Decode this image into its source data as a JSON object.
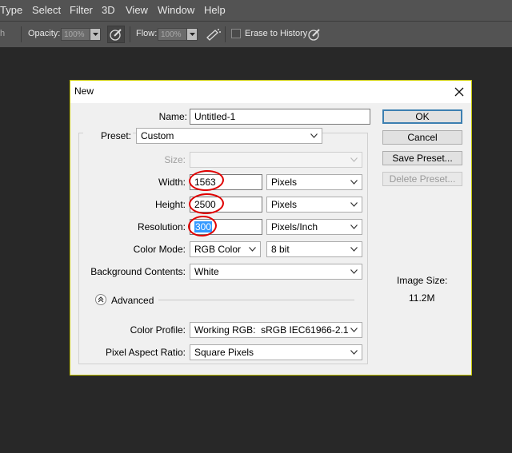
{
  "menubar": {
    "items": [
      "Type",
      "Select",
      "Filter",
      "3D",
      "View",
      "Window",
      "Help"
    ]
  },
  "options_bar": {
    "mode_fragment": "h",
    "opacity_label": "Opacity:",
    "opacity_value": "100%",
    "flow_label": "Flow:",
    "flow_value": "100%",
    "erase_to_history_label": "Erase to History"
  },
  "dialog": {
    "title": "New",
    "name_label": "Name:",
    "name_value": "Untitled-1",
    "preset_label": "Preset:",
    "preset_value": "Custom",
    "size_label": "Size:",
    "size_value": "",
    "width_label": "Width:",
    "width_value": "1563",
    "width_unit": "Pixels",
    "height_label": "Height:",
    "height_value": "2500",
    "height_unit": "Pixels",
    "resolution_label": "Resolution:",
    "resolution_value": "300",
    "resolution_unit": "Pixels/Inch",
    "color_mode_label": "Color Mode:",
    "color_mode_value": "RGB Color",
    "bit_depth_value": "8 bit",
    "background_label": "Background Contents:",
    "background_value": "White",
    "advanced_label": "Advanced",
    "color_profile_label": "Color Profile:",
    "color_profile_value": "Working RGB:  sRGB IEC61966-2.1",
    "pixel_aspect_label": "Pixel Aspect Ratio:",
    "pixel_aspect_value": "Square Pixels",
    "buttons": {
      "ok": "OK",
      "cancel": "Cancel",
      "save_preset": "Save Preset...",
      "delete_preset": "Delete Preset..."
    },
    "image_size_label": "Image Size:",
    "image_size_value": "11.2M"
  },
  "colors": {
    "annotation_red": "#e00000",
    "selection_blue": "#3399ff",
    "dialog_border": "#c8c800"
  }
}
